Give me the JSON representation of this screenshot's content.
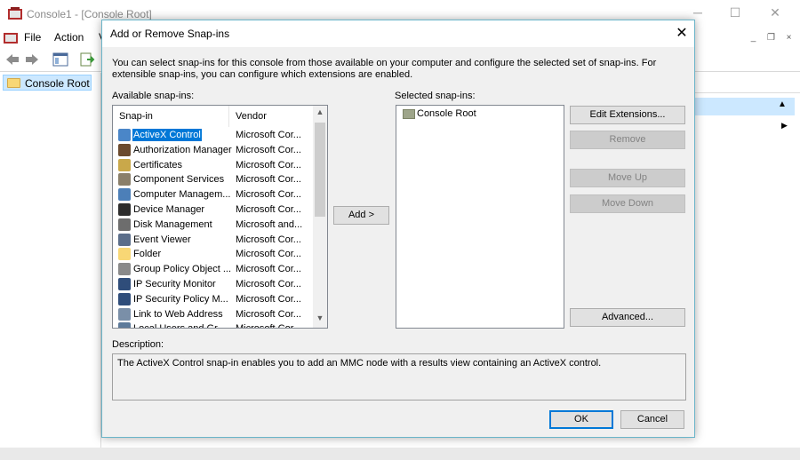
{
  "background_window": {
    "title": "Console1 - [Console Root]",
    "menu": [
      "File",
      "Action",
      "V"
    ],
    "tree_root": "Console Root",
    "window_buttons": {
      "minimize": "─",
      "maximize": "☐",
      "close": "✕"
    },
    "mdi_buttons": {
      "minimize": "_",
      "restore": "❐",
      "close": "×"
    }
  },
  "dialog": {
    "title": "Add or Remove Snap-ins",
    "close_glyph": "✕",
    "intro": "You can select snap-ins for this console from those available on your computer and configure the selected set of snap-ins. For extensible snap-ins, you can configure which extensions are enabled.",
    "available_label": "Available snap-ins:",
    "selected_label": "Selected snap-ins:",
    "columns": {
      "snapin": "Snap-in",
      "vendor": "Vendor"
    },
    "available": [
      {
        "name": "ActiveX Control",
        "vendor": "Microsoft Cor...",
        "icon": "activex-icon",
        "color": "#4a86c8",
        "selected": true
      },
      {
        "name": "Authorization Manager",
        "vendor": "Microsoft Cor...",
        "icon": "authorization-icon",
        "color": "#6b4a2e"
      },
      {
        "name": "Certificates",
        "vendor": "Microsoft Cor...",
        "icon": "certificate-icon",
        "color": "#c9a84a"
      },
      {
        "name": "Component Services",
        "vendor": "Microsoft Cor...",
        "icon": "component-icon",
        "color": "#8a7f6a"
      },
      {
        "name": "Computer Managem...",
        "vendor": "Microsoft Cor...",
        "icon": "computer-icon",
        "color": "#4c7fb8"
      },
      {
        "name": "Device Manager",
        "vendor": "Microsoft Cor...",
        "icon": "device-icon",
        "color": "#2d2d2d"
      },
      {
        "name": "Disk Management",
        "vendor": "Microsoft and...",
        "icon": "disk-icon",
        "color": "#6d6d6d"
      },
      {
        "name": "Event Viewer",
        "vendor": "Microsoft Cor...",
        "icon": "event-icon",
        "color": "#5b6e8a"
      },
      {
        "name": "Folder",
        "vendor": "Microsoft Cor...",
        "icon": "folder-icon",
        "color": "#f8d775"
      },
      {
        "name": "Group Policy Object ...",
        "vendor": "Microsoft Cor...",
        "icon": "group-policy-icon",
        "color": "#8a8a8a"
      },
      {
        "name": "IP Security Monitor",
        "vendor": "Microsoft Cor...",
        "icon": "ip-security-icon",
        "color": "#2f4d7a"
      },
      {
        "name": "IP Security Policy M...",
        "vendor": "Microsoft Cor...",
        "icon": "ip-policy-icon",
        "color": "#2f4d7a"
      },
      {
        "name": "Link to Web Address",
        "vendor": "Microsoft Cor...",
        "icon": "web-link-icon",
        "color": "#7a8fa8"
      },
      {
        "name": "Local Users and Gr...",
        "vendor": "Microsoft Cor...",
        "icon": "users-icon",
        "color": "#5d7a9a"
      }
    ],
    "add_button": "Add >",
    "selected": [
      {
        "name": "Console Root",
        "icon": "folder-icon"
      }
    ],
    "buttons": {
      "edit_extensions": "Edit Extensions...",
      "remove": "Remove",
      "move_up": "Move Up",
      "move_down": "Move Down",
      "advanced": "Advanced...",
      "ok": "OK",
      "cancel": "Cancel"
    },
    "description_label": "Description:",
    "description": "The ActiveX Control snap-in enables you to add an MMC node with a results view containing an ActiveX control."
  },
  "colors": {
    "selection": "#0078d7",
    "dialog_border": "#6bb5c9"
  }
}
